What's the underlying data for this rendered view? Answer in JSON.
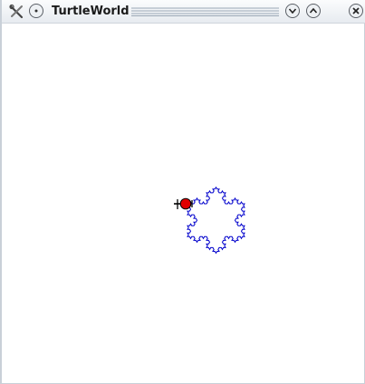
{
  "window": {
    "title": "TurtleWorld"
  },
  "icons": {
    "app": "tools-icon",
    "menu": "window-menu-icon",
    "minimize": "minimize-icon",
    "maximize": "maximize-icon",
    "close": "close-icon",
    "turtle": "turtle-icon"
  },
  "colors": {
    "curve": "#0000cc",
    "turtle_body": "#e00000",
    "turtle_outline": "#000000"
  }
}
